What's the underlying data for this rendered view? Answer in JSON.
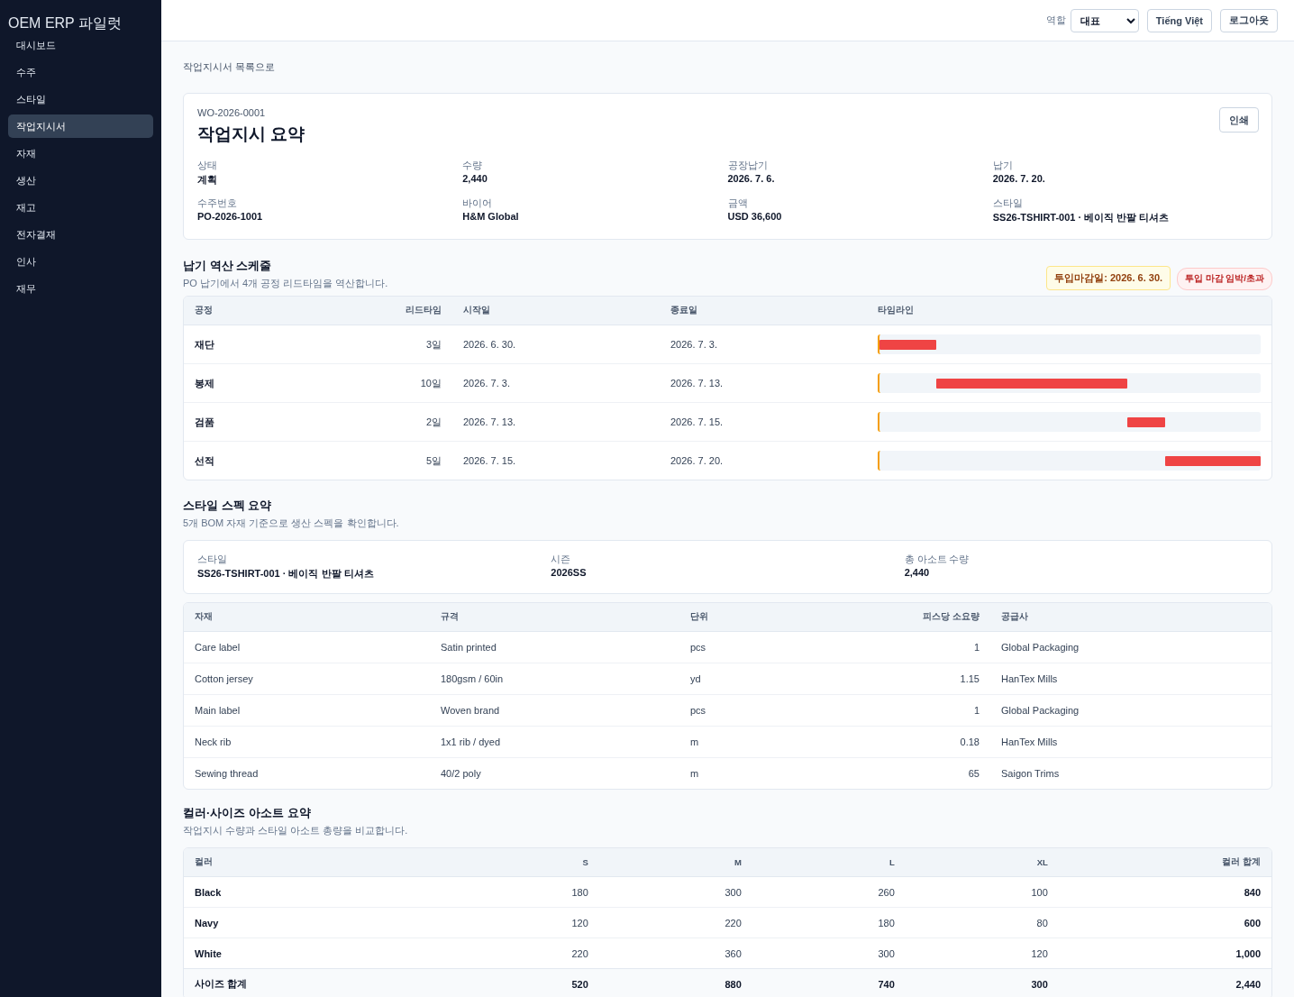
{
  "sidebar": {
    "brand": "OEM ERP 파일럿",
    "items": [
      {
        "label": "대시보드",
        "selected": false
      },
      {
        "label": "수주",
        "selected": false
      },
      {
        "label": "스타일",
        "selected": false
      },
      {
        "label": "작업지시서",
        "selected": true
      },
      {
        "label": "자재",
        "selected": false
      },
      {
        "label": "생산",
        "selected": false
      },
      {
        "label": "재고",
        "selected": false
      },
      {
        "label": "전자결재",
        "selected": false
      },
      {
        "label": "인사",
        "selected": false
      },
      {
        "label": "재무",
        "selected": false
      }
    ]
  },
  "header": {
    "role_label": "역할",
    "role_value": "대표",
    "language_button": "Tiếng Việt",
    "logout_button": "로그아웃"
  },
  "back_link": "작업지시서 목록으로",
  "summary": {
    "code": "WO-2026-0001",
    "title": "작업지시 요약",
    "print_button": "인쇄",
    "fields": [
      {
        "label": "상태",
        "value": "계획"
      },
      {
        "label": "수량",
        "value": "2,440"
      },
      {
        "label": "공장납기",
        "value": "2026. 7. 6."
      },
      {
        "label": "납기",
        "value": "2026. 7. 20."
      },
      {
        "label": "수주번호",
        "value": "PO-2026-1001"
      },
      {
        "label": "바이어",
        "value": "H&M Global"
      },
      {
        "label": "금액",
        "value": "USD 36,600"
      },
      {
        "label": "스타일",
        "value": "SS26-TSHIRT-001 · 베이직 반팔 티셔츠"
      }
    ]
  },
  "schedule": {
    "title": "납기 역산 스케줄",
    "subtitle": "PO 납기에서 4개 공정 리드타임을 역산합니다.",
    "deadline_badge": "투입마감일: 2026. 6. 30.",
    "alert_badge": "투입 마감 임박/초과",
    "columns": [
      "공정",
      "리드타임",
      "시작일",
      "종료일",
      "타임라인"
    ],
    "rows": [
      {
        "process": "재단",
        "lead_time": "3일",
        "start": "2026. 6. 30.",
        "end": "2026. 7. 3."
      },
      {
        "process": "봉제",
        "lead_time": "10일",
        "start": "2026. 7. 3.",
        "end": "2026. 7. 13."
      },
      {
        "process": "검품",
        "lead_time": "2일",
        "start": "2026. 7. 13.",
        "end": "2026. 7. 15."
      },
      {
        "process": "선적",
        "lead_time": "5일",
        "start": "2026. 7. 15.",
        "end": "2026. 7. 20."
      }
    ]
  },
  "spec": {
    "title": "스타일 스펙 요약",
    "subtitle": "5개 BOM 자재 기준으로 생산 스펙을 확인합니다.",
    "fields": [
      {
        "label": "스타일",
        "value": "SS26-TSHIRT-001 · 베이직 반팔 티셔츠"
      },
      {
        "label": "시즌",
        "value": "2026SS"
      },
      {
        "label": "총 아소트 수량",
        "value": "2,440"
      }
    ],
    "columns": [
      "자재",
      "규격",
      "단위",
      "피스당 소요량",
      "공급사"
    ],
    "rows": [
      [
        "Care label",
        "Satin printed",
        "pcs",
        "1",
        "Global Packaging"
      ],
      [
        "Cotton jersey",
        "180gsm / 60in",
        "yd",
        "1.15",
        "HanTex Mills"
      ],
      [
        "Main label",
        "Woven brand",
        "pcs",
        "1",
        "Global Packaging"
      ],
      [
        "Neck rib",
        "1x1 rib / dyed",
        "m",
        "0.18",
        "HanTex Mills"
      ],
      [
        "Sewing thread",
        "40/2 poly",
        "m",
        "65",
        "Saigon Trims"
      ]
    ]
  },
  "assort": {
    "title": "컬러·사이즈 아소트 요약",
    "subtitle": "작업지시 수량과 스타일 아소트 총량을 비교합니다.",
    "columns": [
      "컬러",
      "S",
      "M",
      "L",
      "XL",
      "컬러 합계"
    ],
    "rows": [
      [
        "Black",
        "180",
        "300",
        "260",
        "100",
        "840"
      ],
      [
        "Navy",
        "120",
        "220",
        "180",
        "80",
        "600"
      ],
      [
        "White",
        "220",
        "360",
        "300",
        "120",
        "1,000"
      ]
    ],
    "total_row": [
      "사이즈 합계",
      "520",
      "880",
      "740",
      "300",
      "2,440"
    ]
  }
}
